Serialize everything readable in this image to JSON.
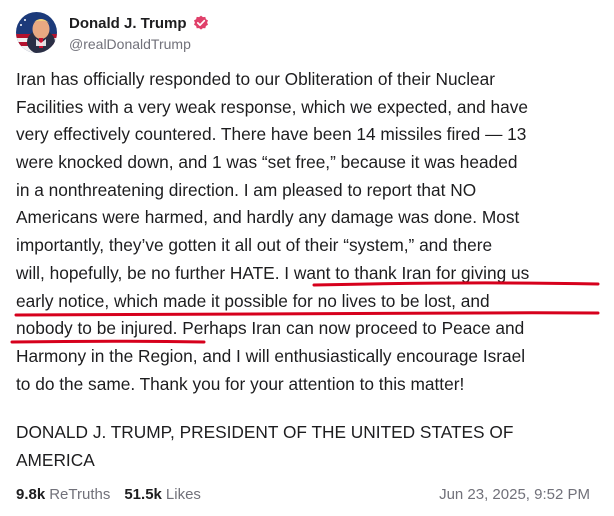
{
  "author": {
    "display_name": "Donald J. Trump",
    "handle": "@realDonaldTrump",
    "verified": true,
    "verified_color": "#e0406a",
    "avatar": "avatar-portrait-with-flag"
  },
  "post": {
    "body_lines": [
      "Iran has officially responded to our Obliteration of their Nuclear",
      "Facilities with a very weak response, which we expected, and have",
      "very effectively countered. There have been 14 missiles fired — 13",
      "were knocked down, and 1 was “set free,” because it was headed",
      "in a nonthreatening direction. I am pleased to report that NO",
      "Americans were harmed, and hardly any damage was done. Most",
      "importantly, they’ve gotten it all out of their “system,” and there",
      "will, hopefully, be no further HATE. I want to thank Iran for giving us",
      "early notice, which made it possible for no lives to be lost, and",
      "nobody to be injured. Perhaps Iran can now proceed to Peace and",
      "Harmony in the Region, and I will enthusiastically encourage Israel",
      "to do the same. Thank you for your attention to this matter!"
    ],
    "signature_lines": [
      "DONALD J. TRUMP, PRESIDENT OF THE UNITED STATES OF",
      "AMERICA"
    ],
    "annotation_color": "#d6001c"
  },
  "stats": {
    "retruths_count": "9.8k",
    "retruths_label": "ReTruths",
    "likes_count": "51.5k",
    "likes_label": "Likes"
  },
  "timestamp": "Jun 23, 2025, 9:52 PM"
}
